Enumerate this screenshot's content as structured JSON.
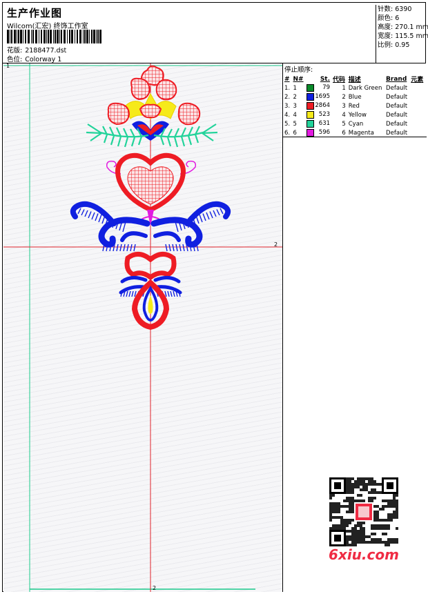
{
  "header": {
    "title": "生产作业图",
    "company": "Wilcom(汇宏) 终饰工作室",
    "design_label": "花版:",
    "design_file": "2188477.dst",
    "colorway_label": "色位:",
    "colorway": "Colorway 1"
  },
  "stats": [
    {
      "label": "针数:",
      "value": "6390"
    },
    {
      "label": "颜色:",
      "value": "6"
    },
    {
      "label": "高度:",
      "value": "270.1 mm"
    },
    {
      "label": "宽度:",
      "value": "115.5 mm"
    },
    {
      "label": "比例:",
      "value": "0.95"
    }
  ],
  "stop_sequence": {
    "title": "停止顺序:",
    "columns": [
      "#",
      "N#",
      "St.",
      "代码",
      "描述",
      "Brand",
      "元素"
    ],
    "rows": [
      {
        "idx": "1.",
        "n": "1",
        "stitches": "79",
        "code": "1",
        "desc": "Dark Green",
        "brand": "Default",
        "color": "#0a8a2a"
      },
      {
        "idx": "2.",
        "n": "2",
        "stitches": "1695",
        "code": "2",
        "desc": "Blue",
        "brand": "Default",
        "color": "#1020e0"
      },
      {
        "idx": "3.",
        "n": "3",
        "stitches": "2864",
        "code": "3",
        "desc": "Red",
        "brand": "Default",
        "color": "#ee1c24"
      },
      {
        "idx": "4.",
        "n": "4",
        "stitches": "523",
        "code": "4",
        "desc": "Yellow",
        "brand": "Default",
        "color": "#f6ea1a"
      },
      {
        "idx": "5.",
        "n": "5",
        "stitches": "631",
        "code": "5",
        "desc": "Cyan",
        "brand": "Default",
        "color": "#22d39a"
      },
      {
        "idx": "6.",
        "n": "6",
        "stitches": "596",
        "code": "6",
        "desc": "Magenta",
        "brand": "Default",
        "color": "#e21adf"
      }
    ]
  },
  "canvas": {
    "axis_labels": [
      "1",
      "2",
      "2"
    ]
  },
  "watermark": {
    "text": "6xiu.com",
    "qr_stamp": "图网"
  },
  "colors": {
    "green": "#0a8a2a",
    "blue": "#1020e0",
    "red": "#ee1c24",
    "yellow": "#f6ea1a",
    "cyan": "#22d39a",
    "magenta": "#e21adf",
    "guide_cyan": "#19c98a",
    "guide_red": "#e0212a"
  }
}
